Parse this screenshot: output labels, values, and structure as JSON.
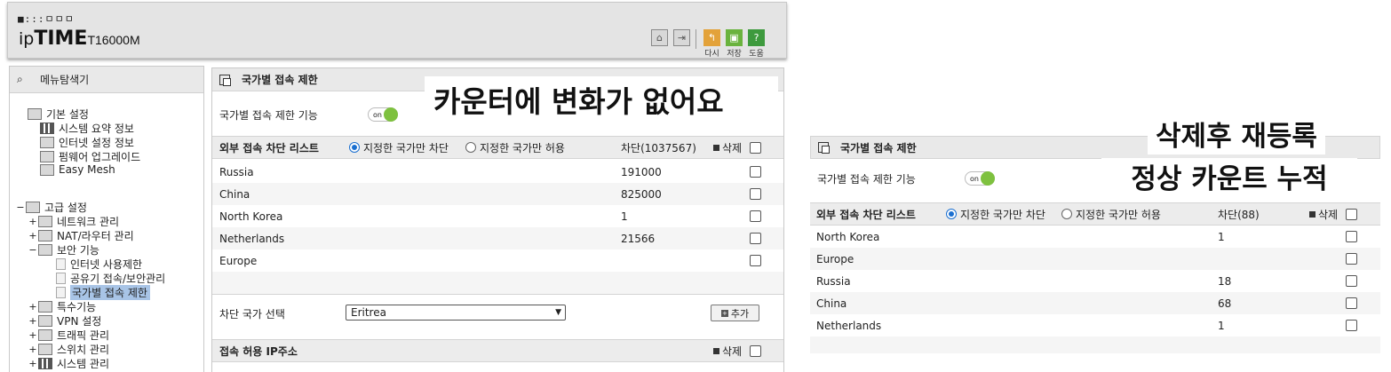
{
  "header": {
    "logo_top": "■:::ㅁㅁㅁ",
    "brand_prefix": "ip",
    "brand_main": "TIME",
    "model": "T16000M",
    "buttons": [
      {
        "label": "다시"
      },
      {
        "label": "저장"
      },
      {
        "label": "도움"
      }
    ],
    "colors": {
      "restart": "#e3a23a",
      "save": "#6ab33e",
      "help": "#3e9a3e"
    }
  },
  "sidebar": {
    "title": "메뉴탐색기",
    "basic_group": "기본 설정",
    "basic_items": [
      "시스템 요약 정보",
      "인터넷 설정 정보",
      "펌웨어 업그레이드",
      "Easy Mesh"
    ],
    "advanced_group": "고급 설정",
    "advanced_items": [
      "네트워크 관리",
      "NAT/라우터 관리",
      "보안 기능"
    ],
    "security_items": [
      "인터넷 사용제한",
      "공유기 접속/보안관리",
      "국가별 접속 제한"
    ],
    "more_items": [
      "특수기능",
      "VPN 설정",
      "트래픽 관리",
      "스위치 관리",
      "시스템 관리"
    ],
    "selected_color": "#a8c4e6"
  },
  "panel1": {
    "title": "국가별 접속 제한",
    "function_label": "국가별 접속 제한 기능",
    "toggle": "on",
    "list_title": "외부 접속 차단 리스트",
    "radio_block": "지정한 국가만 차단",
    "radio_allow": "지정한 국가만 허용",
    "blocked_header": "차단(1037567)",
    "delete_label": "삭제",
    "rows": [
      {
        "country": "Russia",
        "count": "191000"
      },
      {
        "country": "China",
        "count": "825000"
      },
      {
        "country": "North Korea",
        "count": "1"
      },
      {
        "country": "Netherlands",
        "count": "21566"
      },
      {
        "country": "Europe",
        "count": ""
      }
    ],
    "select_label": "차단 국가 선택",
    "select_value": "Eritrea",
    "add_label": "추가",
    "allow_ip_title": "접속 허용 IP주소",
    "allow_delete_label": "삭제"
  },
  "annotations": {
    "no_change": "카운터에 변화가 없어요",
    "reregister_line1": "삭제후 재등록",
    "reregister_line2": "정상 카운트 누적"
  },
  "panel2": {
    "title": "국가별 접속 제한",
    "function_label": "국가별 접속 제한 기능",
    "toggle": "on",
    "list_title": "외부 접속 차단 리스트",
    "radio_block": "지정한 국가만 차단",
    "radio_allow": "지정한 국가만 허용",
    "blocked_header": "차단(88)",
    "delete_label": "삭제",
    "rows": [
      {
        "country": "North Korea",
        "count": "1"
      },
      {
        "country": "Europe",
        "count": ""
      },
      {
        "country": "Russia",
        "count": "18"
      },
      {
        "country": "China",
        "count": "68"
      },
      {
        "country": "Netherlands",
        "count": "1"
      }
    ]
  },
  "toggle_color": "#7ec13f"
}
